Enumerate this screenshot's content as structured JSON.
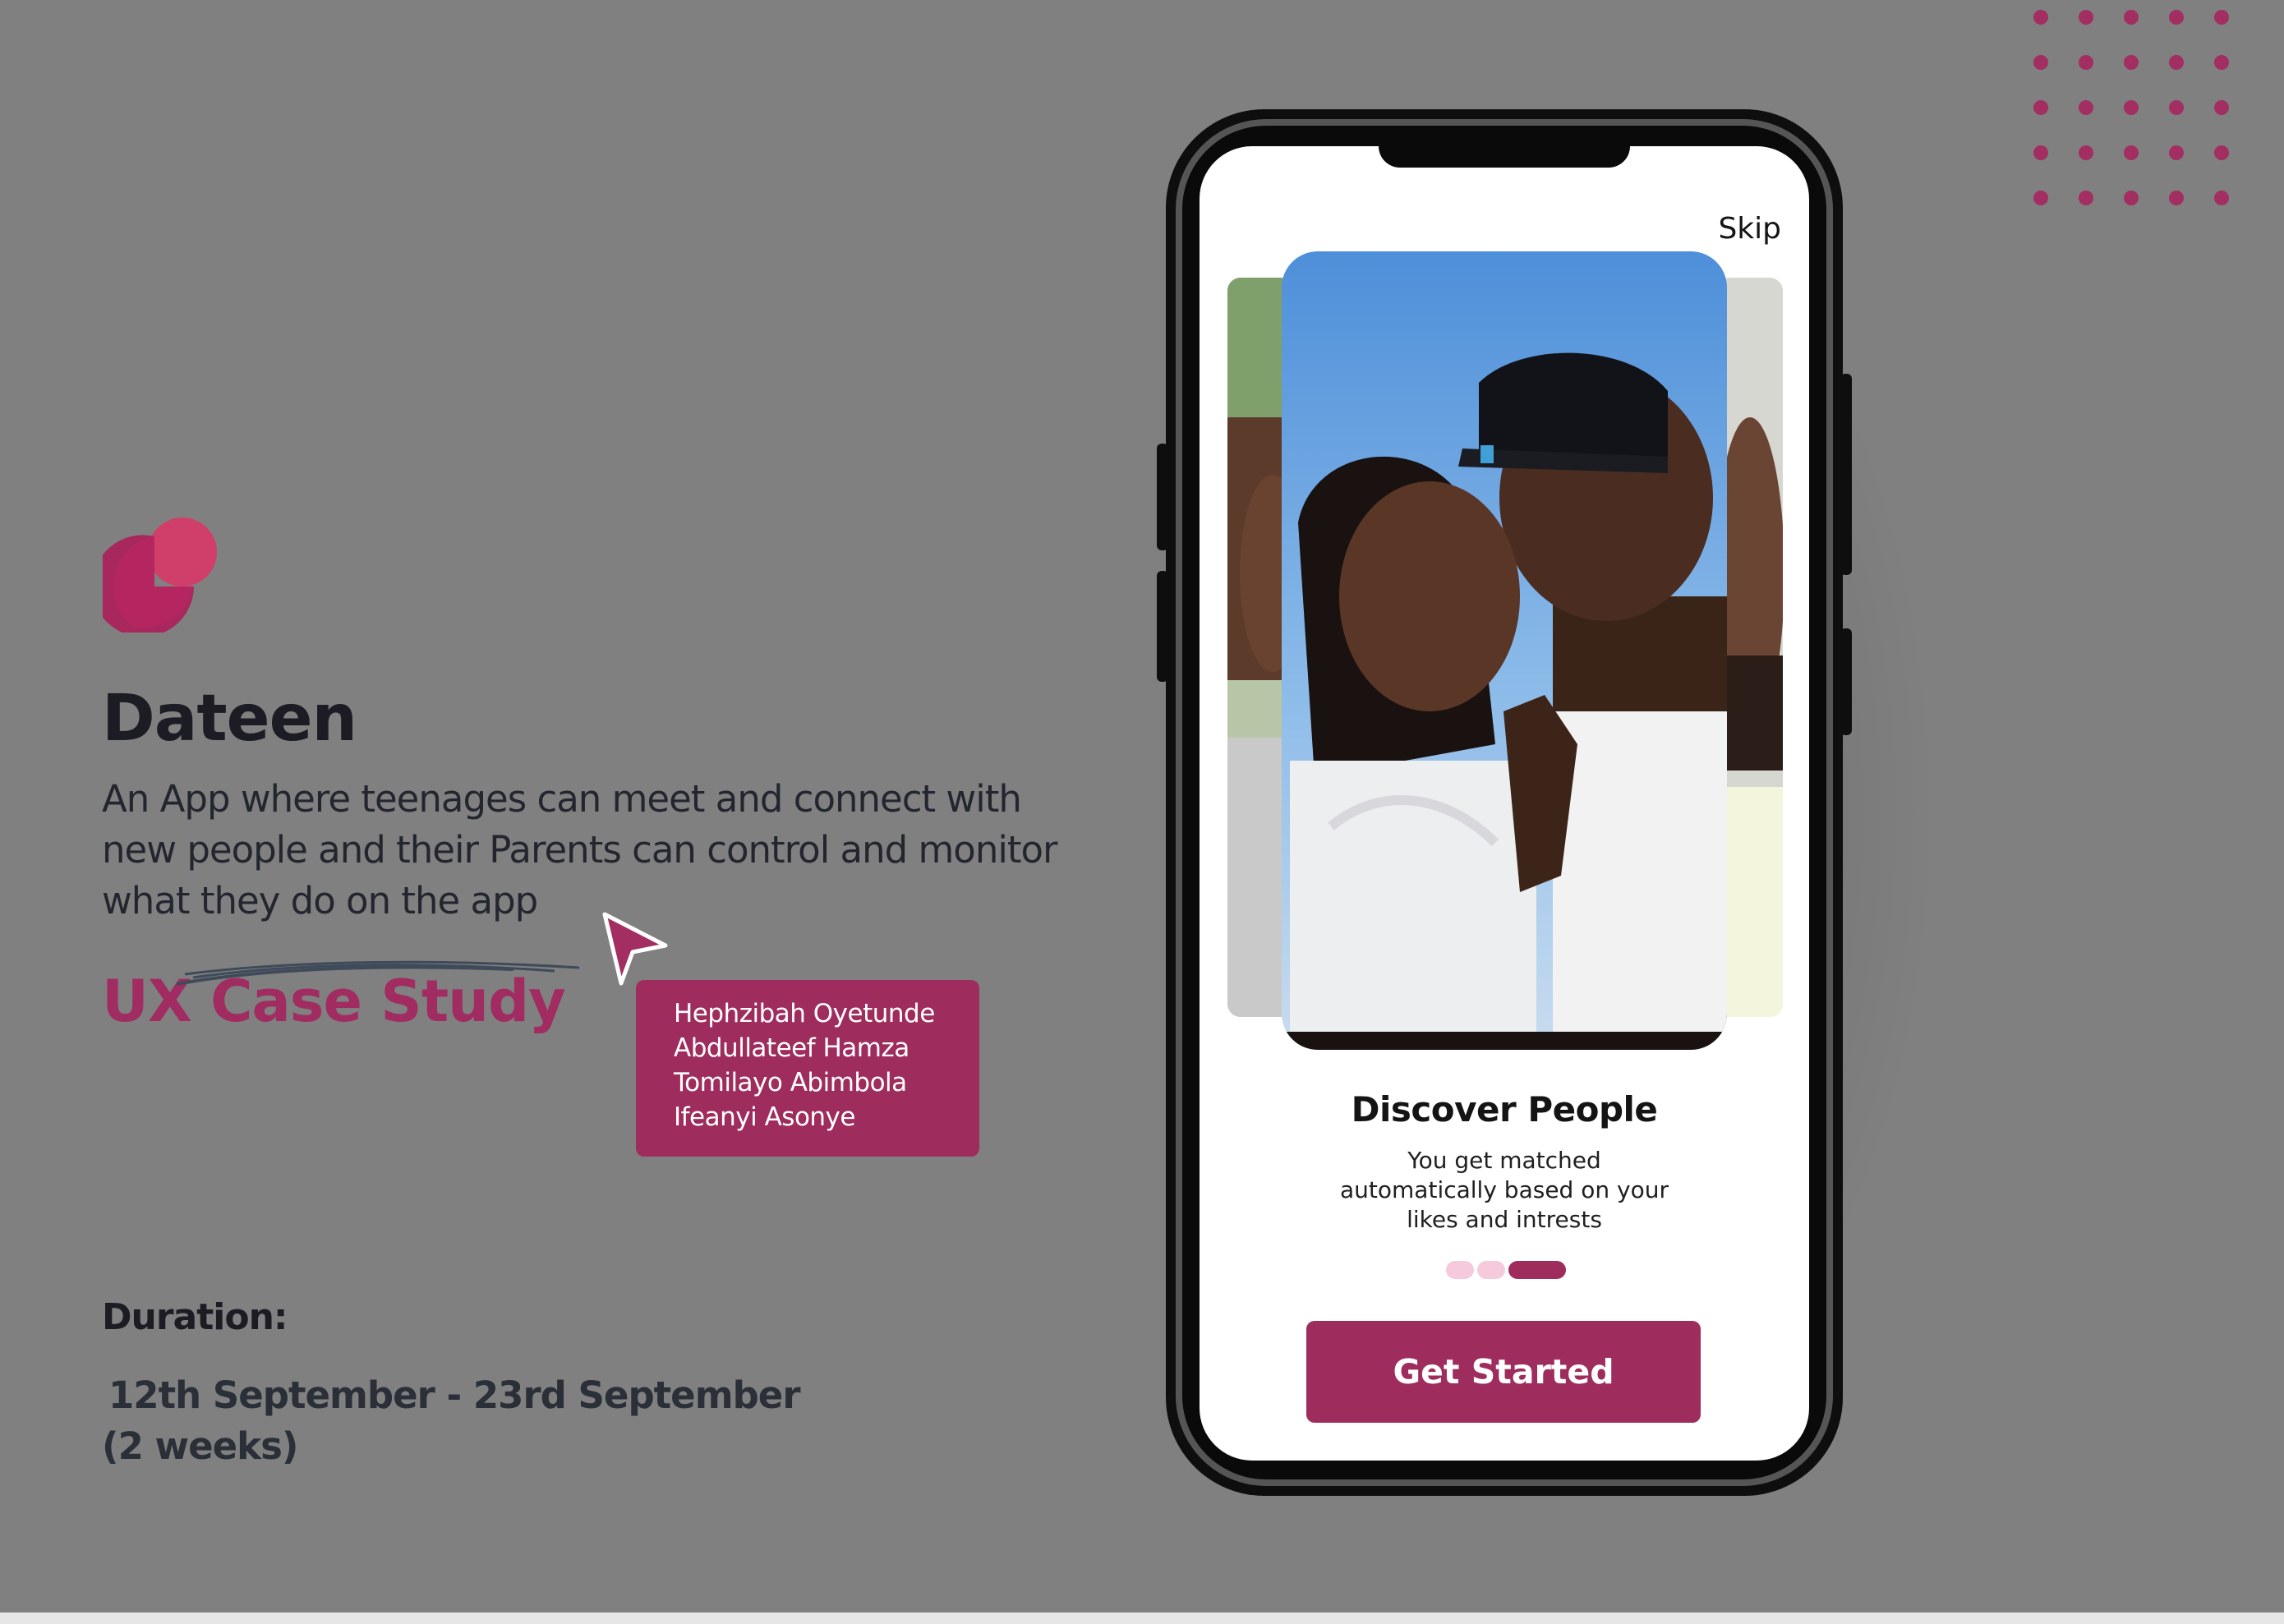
{
  "brand": {
    "app_name": "Dateen",
    "description": "An App where teenages can meet and connect with new people and their Parents can control and monitor what they do on the app",
    "case_study_label": "UX Case Study",
    "accent_color": "#9e2d5d",
    "logo_icon": "logo-overlapping-circles-icon"
  },
  "team": {
    "members": [
      "Hephzibah Oyetunde",
      "Abdullateef Hamza",
      "Tomilayo Abimbola",
      "Ifeanyi Asonye"
    ]
  },
  "duration": {
    "label": "Duration:",
    "dates": "12th September - 23rd September",
    "length": "(2 weeks)"
  },
  "phone": {
    "skip_label": "Skip",
    "onboarding_title": "Discover People",
    "onboarding_description": "You get matched automatically based on your likes and intrests",
    "pager": {
      "total_pages": 3,
      "active_page": 3
    },
    "cta_label": "Get Started"
  }
}
